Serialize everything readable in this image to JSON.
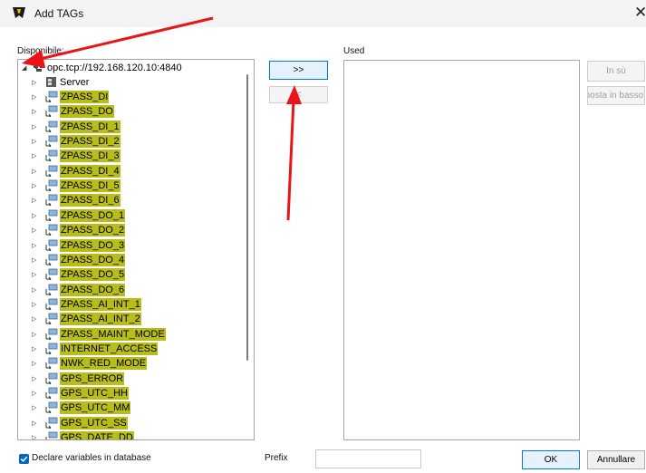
{
  "window": {
    "title": "Add TAGs",
    "close_glyph": "✕"
  },
  "labels": {
    "available": "Disponibile:",
    "used": "Used",
    "prefix": "Prefix"
  },
  "tree": {
    "root_label": "opc.tcp://192.168.120.10:4840",
    "server_label": "Server",
    "items": [
      "ZPASS_DI",
      "ZPASS_DO",
      "ZPASS_DI_1",
      "ZPASS_DI_2",
      "ZPASS_DI_3",
      "ZPASS_DI_4",
      "ZPASS_DI_5",
      "ZPASS_DI_6",
      "ZPASS_DO_1",
      "ZPASS_DO_2",
      "ZPASS_DO_3",
      "ZPASS_DO_4",
      "ZPASS_DO_5",
      "ZPASS_DO_6",
      "ZPASS_AI_INT_1",
      "ZPASS_AI_INT_2",
      "ZPASS_MAINT_MODE",
      "INTERNET_ACCESS",
      "NWK_RED_MODE",
      "GPS_ERROR",
      "GPS_UTC_HH",
      "GPS_UTC_MM",
      "GPS_UTC_SS",
      "GPS_DATE_DD"
    ],
    "highlight_color": "#b8bd1c"
  },
  "buttons": {
    "add_all": ">>",
    "remove": "<",
    "move_up": "In sù",
    "move_down": "Sposta in basso",
    "ok": "OK",
    "cancel": "Annullare"
  },
  "declare_checkbox": {
    "label": "Declare variables in database",
    "checked": true
  },
  "prefix_value": "",
  "annotation_color": "#e8141a"
}
